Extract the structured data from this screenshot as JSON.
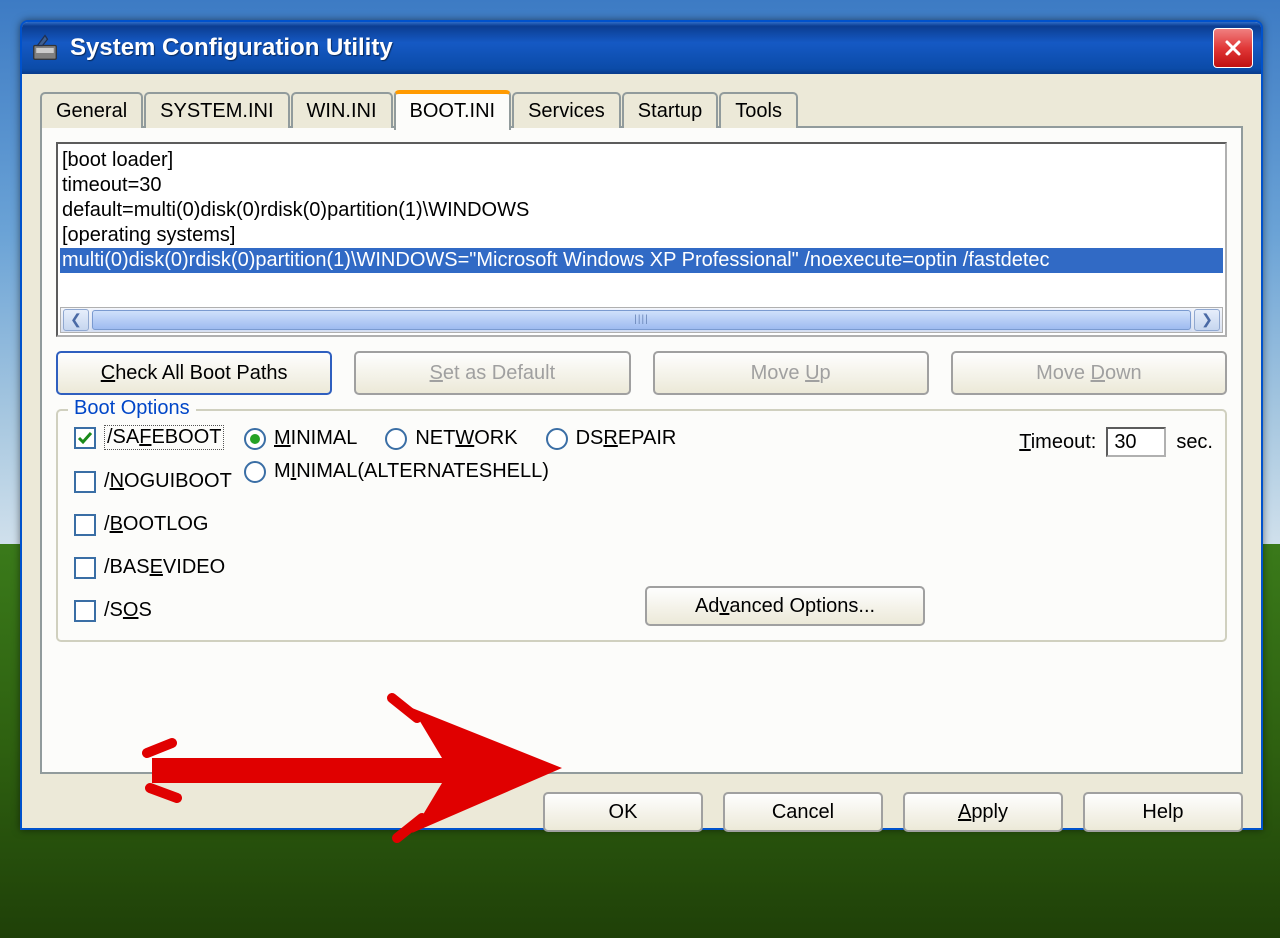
{
  "window": {
    "title": "System Configuration Utility"
  },
  "tabs": {
    "general": "General",
    "systemini": "SYSTEM.INI",
    "winini": "WIN.INI",
    "bootini": "BOOT.INI",
    "services": "Services",
    "startup": "Startup",
    "tools": "Tools"
  },
  "bootini_text": {
    "l0": "[boot loader]",
    "l1": "timeout=30",
    "l2": "default=multi(0)disk(0)rdisk(0)partition(1)\\WINDOWS",
    "l3": "[operating systems]",
    "l4": "multi(0)disk(0)rdisk(0)partition(1)\\WINDOWS=\"Microsoft Windows XP Professional\" /noexecute=optin /fastdetec"
  },
  "buttons": {
    "check_all": "Check All Boot Paths",
    "set_default": "Set as Default",
    "move_up": "Move Up",
    "move_down": "Move Down",
    "advanced": "Advanced Options...",
    "ok": "OK",
    "cancel": "Cancel",
    "apply": "Apply",
    "help": "Help"
  },
  "group": {
    "title": "Boot Options",
    "safeboot": "/SAFEBOOT",
    "noguiboot": "/NOGUIBOOT",
    "bootlog": "/BOOTLOG",
    "basevideo": "/BASEVIDEO",
    "sos": "/SOS",
    "minimal": "MINIMAL",
    "network": "NETWORK",
    "dsrepair": "DSREPAIR",
    "minimal_alt": "MINIMAL(ALTERNATESHELL)",
    "timeout_label": "Timeout:",
    "timeout_value": "30",
    "timeout_unit": "sec."
  }
}
